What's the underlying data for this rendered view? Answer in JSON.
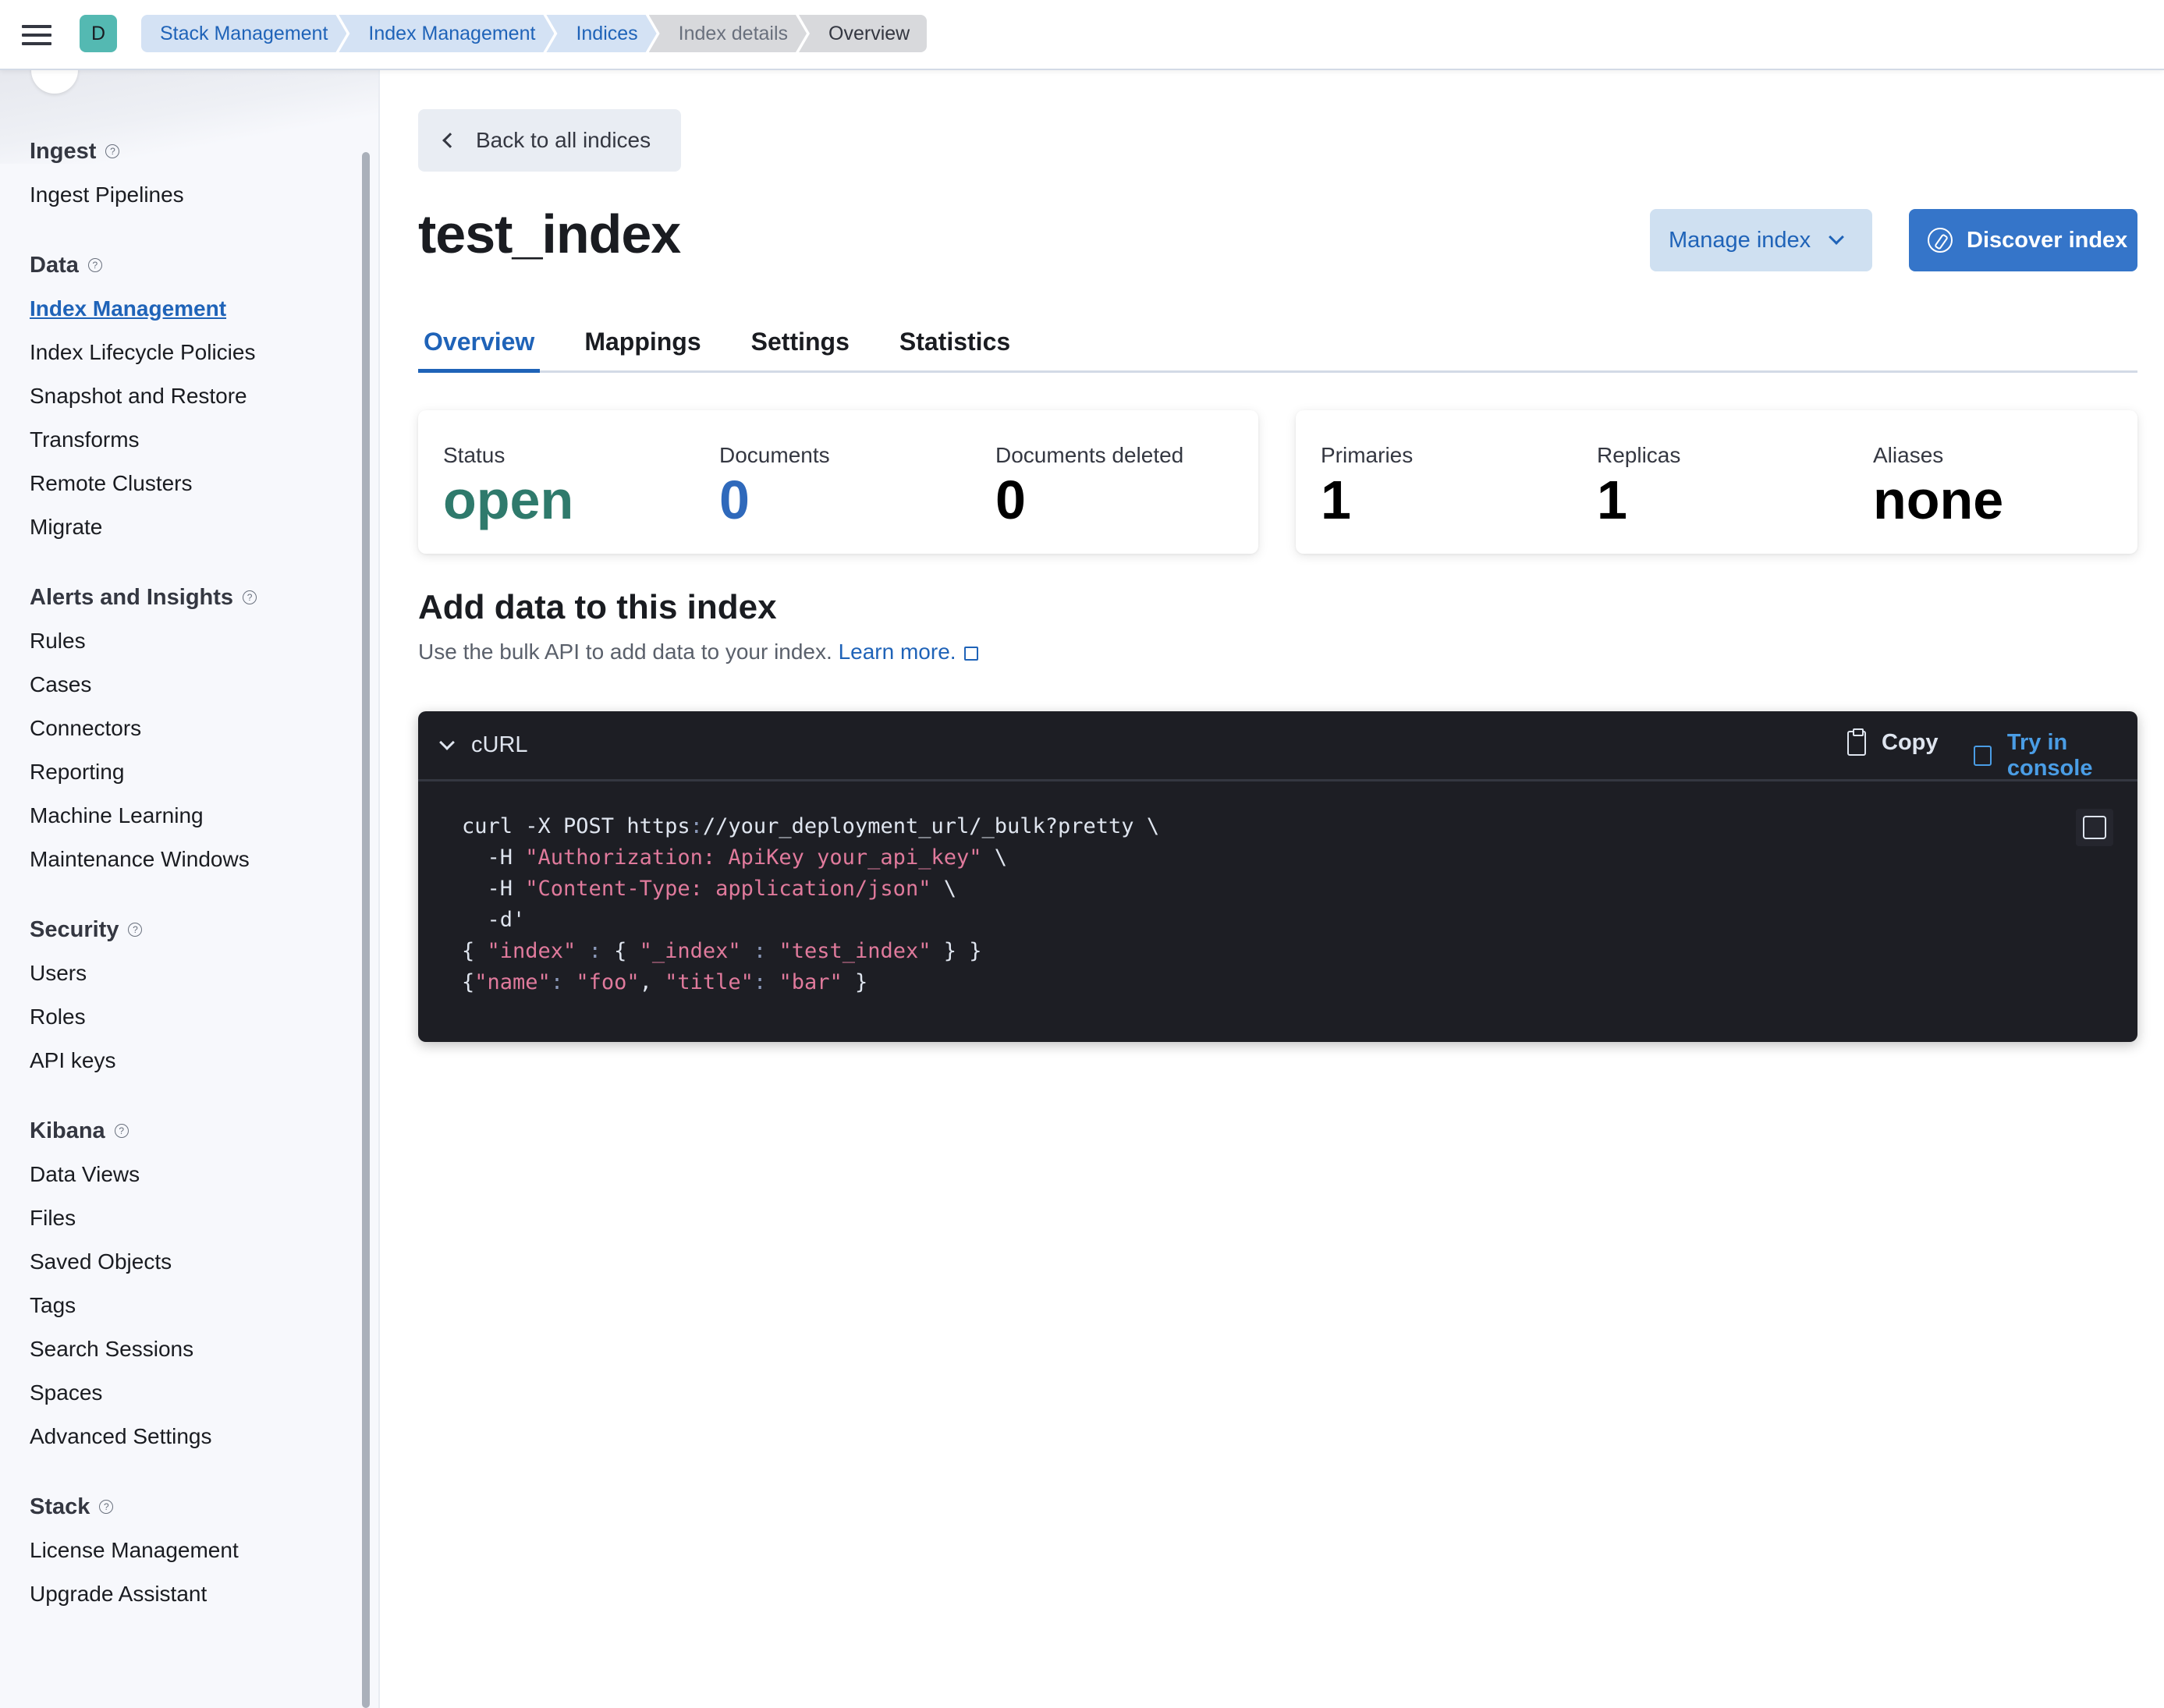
{
  "header": {
    "space_initial": "D",
    "breadcrumbs": [
      {
        "label": "Stack Management",
        "state": "link"
      },
      {
        "label": "Index Management",
        "state": "link"
      },
      {
        "label": "Indices",
        "state": "link"
      },
      {
        "label": "Index details",
        "state": "muted"
      },
      {
        "label": "Overview",
        "state": "current"
      }
    ]
  },
  "sidebar": {
    "groups": [
      {
        "title": "Ingest",
        "items": [
          "Ingest Pipelines"
        ]
      },
      {
        "title": "Data",
        "items": [
          "Index Management",
          "Index Lifecycle Policies",
          "Snapshot and Restore",
          "Transforms",
          "Remote Clusters",
          "Migrate"
        ],
        "active": "Index Management"
      },
      {
        "title": "Alerts and Insights",
        "items": [
          "Rules",
          "Cases",
          "Connectors",
          "Reporting",
          "Machine Learning",
          "Maintenance Windows"
        ]
      },
      {
        "title": "Security",
        "items": [
          "Users",
          "Roles",
          "API keys"
        ]
      },
      {
        "title": "Kibana",
        "items": [
          "Data Views",
          "Files",
          "Saved Objects",
          "Tags",
          "Search Sessions",
          "Spaces",
          "Advanced Settings"
        ]
      },
      {
        "title": "Stack",
        "items": [
          "License Management",
          "Upgrade Assistant"
        ]
      }
    ]
  },
  "main": {
    "back_label": "Back to all indices",
    "title": "test_index",
    "manage_label": "Manage index",
    "discover_label": "Discover index",
    "tabs": [
      {
        "label": "Overview",
        "active": true
      },
      {
        "label": "Mappings",
        "active": false
      },
      {
        "label": "Settings",
        "active": false
      },
      {
        "label": "Statistics",
        "active": false
      }
    ],
    "stats_left": [
      {
        "label": "Status",
        "value": "open",
        "color": "#2f7a6c"
      },
      {
        "label": "Documents",
        "value": "0",
        "color": "#2f69bb"
      },
      {
        "label": "Documents deleted",
        "value": "0",
        "color": "#000000"
      }
    ],
    "stats_right": [
      {
        "label": "Primaries",
        "value": "1"
      },
      {
        "label": "Replicas",
        "value": "1"
      },
      {
        "label": "Aliases",
        "value": "none"
      }
    ],
    "add_data": {
      "title": "Add data to this index",
      "description": "Use the bulk API to add data to your index.",
      "learn_more": "Learn more."
    },
    "code": {
      "language_label": "cURL",
      "copy_label": "Copy",
      "console_label": "Try in console",
      "lines": [
        "curl -X POST https://your_deployment_url/_bulk?pretty \\",
        "  -H \"Authorization: ApiKey your_api_key\" \\",
        "  -H \"Content-Type: application/json\" \\",
        "  -d'",
        "{ \"index\" : { \"_index\" : \"test_index\" } }",
        "{\"name\": \"foo\", \"title\": \"bar\" }"
      ]
    }
  },
  "colors": {
    "accent": "#1f63b8",
    "primary_button": "#3575c9",
    "status_open": "#2f7a6c",
    "code_bg": "#1d1e24",
    "code_string": "#e07a9c"
  }
}
